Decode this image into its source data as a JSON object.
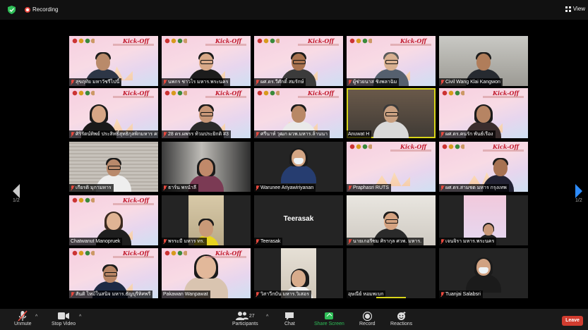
{
  "topbar": {
    "recording_label": "Recording",
    "view_label": "View"
  },
  "pagination": {
    "left": "1/2",
    "right": "1/2"
  },
  "poster_title": "Kick-Off",
  "colors": {
    "leave": "#d13c2f",
    "share": "#2fbf58",
    "active_border": "#d8d51a",
    "muted_mic": "#e84a3f"
  },
  "participants": [
    {
      "name": "สุขฤทัย มหาวัชรีไปนี้"
    },
    {
      "name": "นพกร ชาวไร มหาร.พระนคร"
    },
    {
      "name": "ผศ.ดร.วีศักดิ์ สมรักษ์"
    },
    {
      "name": "ผู้ช่วยนาส ชิงพลาฉิม"
    },
    {
      "name": "Civil Wang Klai Kangwon"
    },
    {
      "name": "ศิริรัตน์ทิพย์ ประสิทธิ์สุทธิกุลพิกมหาร ควร..."
    },
    {
      "name": "28 ดร.ผพรร ท้วมประยิกติ #3"
    },
    {
      "name": "ศรีนาห์ วุฒก ผวพ.มหาร.ล้านนา"
    },
    {
      "name": "Anuwat H"
    },
    {
      "name": "ผศ.ดร.คนรัก พันธ์เรือง"
    },
    {
      "name": "เกียรติ มุกามหาร"
    },
    {
      "name": "ธาร์น พรนำลี"
    },
    {
      "name": "Warunee Ariyawiriyanan"
    },
    {
      "name": "Praphasri RUTS"
    },
    {
      "name": "ผศ.ดร.สามชต มหาร กรุงเทพ"
    },
    {
      "name": "Chatwanut Manopruek"
    },
    {
      "name": "พรระมี มหาร ทร."
    },
    {
      "name": "Teerasak"
    },
    {
      "name": "นายเกอรีซม ศิรากุล ศวพ. มหาร."
    },
    {
      "name": "เจนจิรา มหาร.พระนคร"
    },
    {
      "name": "สันติ ไหม้ในสนิจ มหาร.ธัญบุรีทิศพรี"
    },
    {
      "name": "Pakawan Wanpawat"
    },
    {
      "name": "วิสาวีกบัน มหาร.วิเสอร"
    },
    {
      "name": "อุษณีย์ หอมพเบก"
    },
    {
      "name": "Tuanjai Salabsri"
    }
  ],
  "center_labels": {
    "teerasak": "Teerasak"
  },
  "toolbar": {
    "unmute": "Unmute",
    "stop_video": "Stop Video",
    "participants": "Participants",
    "participants_count": "27",
    "chat": "Chat",
    "share_screen": "Share Screen",
    "record": "Record",
    "reactions": "Reactions",
    "leave": "Leave"
  }
}
